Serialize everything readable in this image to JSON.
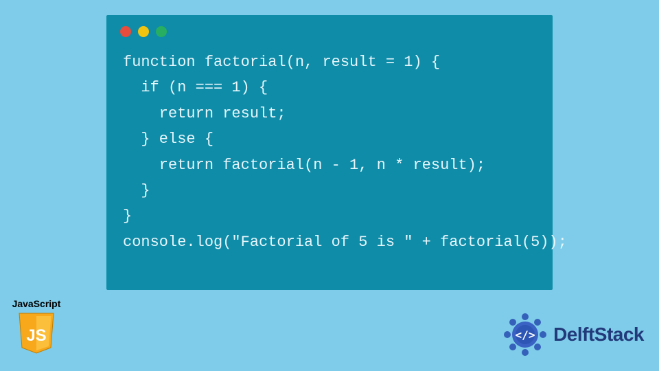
{
  "window": {
    "dots": {
      "red": "#e74c3c",
      "yellow": "#f1c40f",
      "green": "#27ae60"
    }
  },
  "code": {
    "l1": "function factorial(n, result = 1) {",
    "l2": "  if (n === 1) {",
    "l3": "    return result;",
    "l4": "  } else {",
    "l5": "    return factorial(n - 1, n * result);",
    "l6": "  }",
    "l7": "}",
    "l8": "console.log(\"Factorial of 5 is \" + factorial(5));"
  },
  "js_badge": {
    "label": "JavaScript",
    "shield_text": "JS"
  },
  "brand": {
    "name": "DelftStack"
  },
  "colors": {
    "page_bg": "#7ecce9",
    "window_bg": "#0f8ca8",
    "code_text": "#e6f6fb",
    "shield_fill": "#f7a81b",
    "brand_blue": "#223a7a"
  }
}
